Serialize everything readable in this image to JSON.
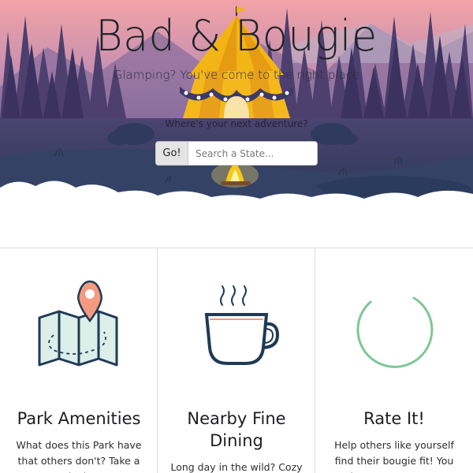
{
  "hero": {
    "title": "Bad & Bougie",
    "tagline": "Glamping? You've come to the right place",
    "prompt": "Where's your next adventure?",
    "go_label": "Go!",
    "search_placeholder": "Search a State..."
  },
  "features": [
    {
      "title": "Park Amenities",
      "text": "What does this Park have that others don't? Take a look",
      "icon": "map-pin-icon"
    },
    {
      "title": "Nearby Fine Dining",
      "text": "Long day in the wild? Cozy",
      "icon": "coffee-cup-icon"
    },
    {
      "title": "Rate It!",
      "text": "Help others like yourself find their bougie fit! You know you want to",
      "icon": "loading-ring-icon"
    }
  ],
  "colors": {
    "accent_green": "#7fc795",
    "pin": "#f39a7f",
    "icon_stroke": "#1f3a55",
    "tent": "#f2b515"
  }
}
